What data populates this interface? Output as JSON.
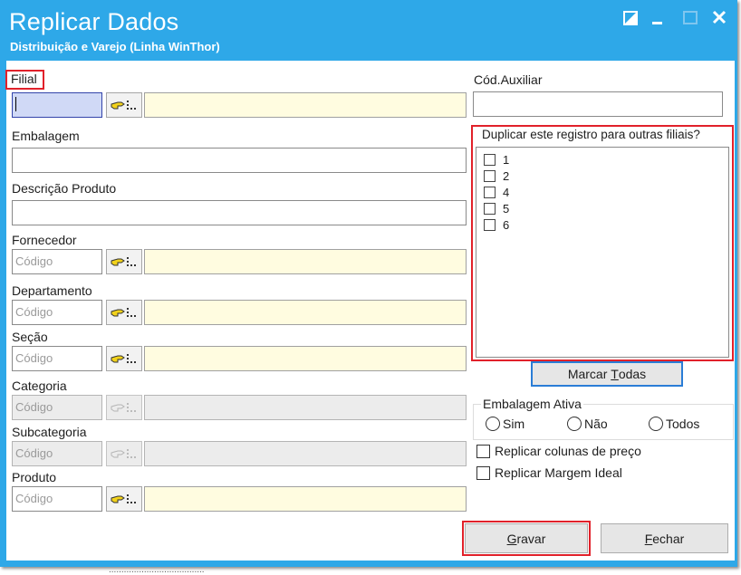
{
  "window": {
    "title": "Replicar Dados",
    "subtitle": "Distribuição e Varejo (Linha WinThor)",
    "title_bar_color": "#2ea8e8"
  },
  "fields": {
    "filial": {
      "label": "Filial",
      "value": ""
    },
    "embalagem": {
      "label": "Embalagem",
      "value": ""
    },
    "descricao": {
      "label": "Descrição Produto",
      "value": ""
    },
    "fornecedor": {
      "label": "Fornecedor",
      "placeholder": "Código"
    },
    "departamento": {
      "label": "Departamento",
      "placeholder": "Código"
    },
    "secao": {
      "label": "Seção",
      "placeholder": "Código"
    },
    "categoria": {
      "label": "Categoria",
      "placeholder": "Código"
    },
    "subcategoria": {
      "label": "Subcategoria",
      "placeholder": "Código"
    },
    "produto": {
      "label": "Produto",
      "placeholder": "Código"
    },
    "cod_auxiliar": {
      "label": "Cód.Auxiliar",
      "value": ""
    }
  },
  "duplicar": {
    "label": "Duplicar este registro para outras filiais?",
    "items": [
      "1",
      "2",
      "4",
      "5",
      "6"
    ],
    "checked": [
      false,
      false,
      false,
      false,
      false
    ]
  },
  "buttons": {
    "marcar_pre": "Marcar ",
    "marcar_acc": "T",
    "marcar_post": "odas",
    "gravar_acc": "G",
    "gravar_post": "ravar",
    "fechar_acc": "F",
    "fechar_post": "echar"
  },
  "embalagem_ativa": {
    "label": "Embalagem Ativa",
    "options": [
      "Sim",
      "Não",
      "Todos"
    ],
    "selected": null
  },
  "options": {
    "replicar_precos": "Replicar colunas de preço",
    "replicar_margem": "Replicar Margem Ideal"
  },
  "colors": {
    "highlight": "#e1212a",
    "lookup_field_bg": "#fffce0",
    "focus_bg": "#d0d9f6"
  },
  "footer_cut_text": "......................................"
}
